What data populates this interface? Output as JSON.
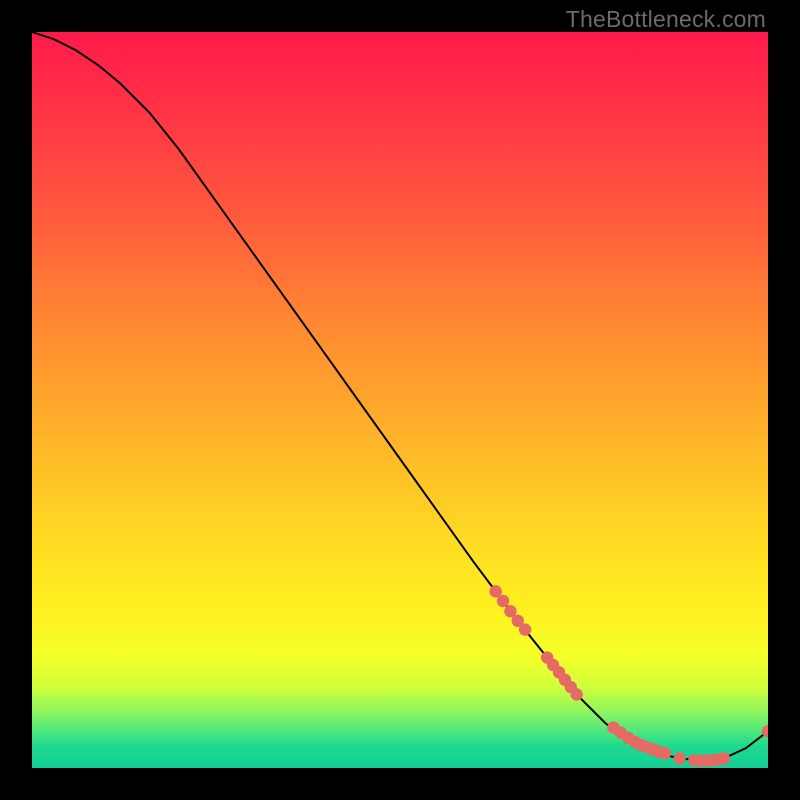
{
  "watermark": "TheBottleneck.com",
  "chart_data": {
    "type": "line",
    "title": "",
    "xlabel": "",
    "ylabel": "",
    "xlim": [
      0,
      100
    ],
    "ylim": [
      0,
      100
    ],
    "grid": false,
    "legend": false,
    "series": [
      {
        "name": "curve",
        "x": [
          0,
          3,
          6,
          9,
          12,
          16,
          20,
          25,
          30,
          35,
          40,
          45,
          50,
          55,
          60,
          63,
          66,
          70,
          74,
          78,
          82,
          85,
          88,
          91,
          94,
          97,
          100
        ],
        "y": [
          100,
          99,
          97.5,
          95.5,
          93,
          89,
          84,
          77,
          70,
          63,
          56,
          49,
          42,
          35,
          28,
          24,
          20,
          15,
          10,
          6,
          3.5,
          2,
          1.3,
          1.0,
          1.3,
          2.7,
          5
        ]
      }
    ],
    "markers": [
      {
        "name": "segment-dots",
        "color": "#e66a63",
        "x": [
          63,
          64,
          65,
          66,
          67,
          70,
          70.8,
          71.6,
          72.4,
          73.2,
          74,
          79,
          80,
          81,
          82,
          82.8,
          83.6,
          84.4,
          85.2,
          86,
          88,
          90,
          90.8,
          91.6,
          92.4,
          93.2,
          94,
          100
        ],
        "y": [
          24,
          22.7,
          21.3,
          20,
          18.8,
          15,
          14,
          13,
          12,
          11,
          10,
          5.5,
          4.8,
          4.1,
          3.5,
          3.1,
          2.8,
          2.5,
          2.2,
          2.0,
          1.3,
          1.05,
          1.0,
          1.0,
          1.05,
          1.15,
          1.3,
          5
        ]
      }
    ]
  }
}
